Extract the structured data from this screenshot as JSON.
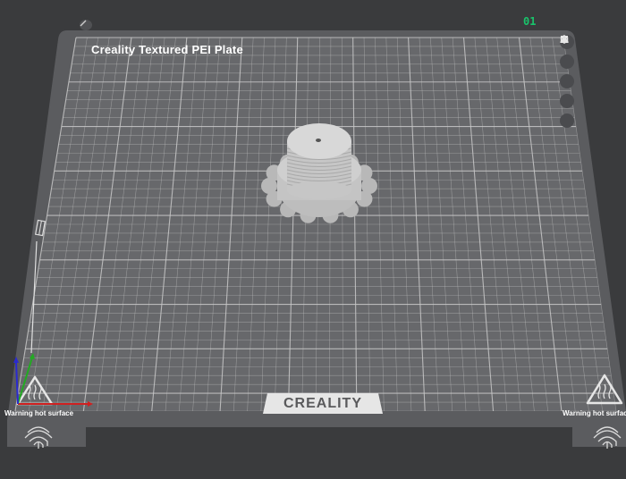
{
  "plate": {
    "title": "Creality Textured PEI Plate",
    "index": "01",
    "brand": "CREALITY",
    "warning_left": "Warning hot surface",
    "warning_right": "Warning hot surface"
  },
  "toolbar": {
    "buttons": [
      {
        "name": "close-plate-button",
        "icon": "close-icon"
      },
      {
        "name": "arrange-button",
        "icon": "arrange-icon"
      },
      {
        "name": "orient-button",
        "icon": "orient-icon"
      },
      {
        "name": "lock-button",
        "icon": "lock-icon"
      },
      {
        "name": "plate-settings-button",
        "icon": "gear-icon"
      }
    ]
  },
  "colors": {
    "background": "#3a3b3d",
    "bed_frame": "#5b5c5f",
    "grid_line": "#c8c8c8",
    "model": "#c9c9c9",
    "plate_index": "#19c36b"
  }
}
